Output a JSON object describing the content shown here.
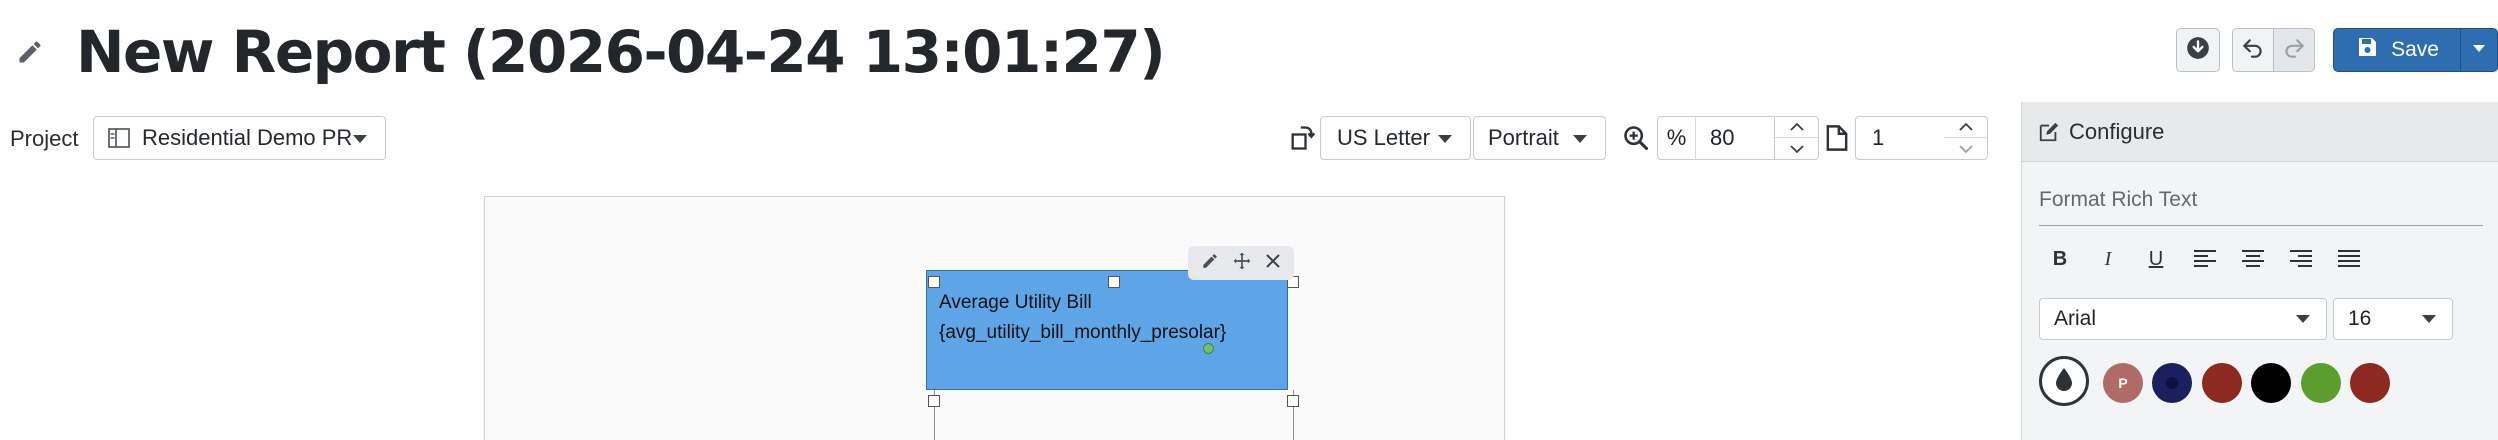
{
  "header": {
    "title": "New Report (2026-04-24 13:01:27)",
    "save_label": "Save"
  },
  "toolbar": {
    "project_label": "Project",
    "project_value": "Residential Demo PR",
    "paper_size": "US Letter",
    "orientation": "Portrait",
    "zoom_unit": "%",
    "zoom_value": "80",
    "page_number": "1"
  },
  "canvas": {
    "text_block": {
      "line1": "Average Utility Bill",
      "line2": "{avg_utility_bill_monthly_presolar}",
      "fill_color": "#5ea5e8"
    }
  },
  "configure_panel": {
    "title": "Configure",
    "section_title": "Format Rich Text",
    "font_family": "Arial",
    "font_size": "16",
    "swatches": [
      {
        "label": "P",
        "color": "#b06b66"
      },
      {
        "label": "",
        "color": "#1a1f5e"
      },
      {
        "label": "",
        "color": "#8c2920"
      },
      {
        "label": "",
        "color": "#000000"
      },
      {
        "label": "",
        "color": "#5b9e2d"
      },
      {
        "label": "",
        "color": "#8c2920"
      }
    ]
  },
  "colors": {
    "primary": "#2f6db1",
    "panel_background": "#f3f4f5"
  }
}
